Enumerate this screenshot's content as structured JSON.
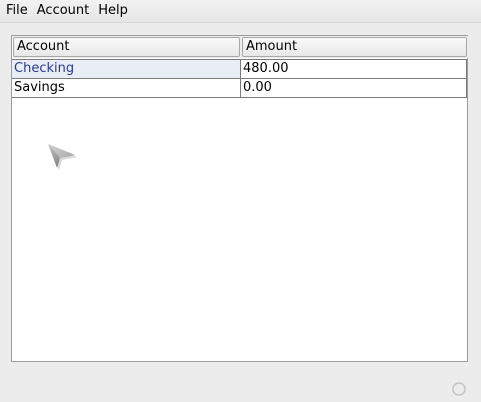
{
  "menubar": {
    "items": [
      {
        "label": "File"
      },
      {
        "label": "Account"
      },
      {
        "label": "Help"
      }
    ]
  },
  "table": {
    "columns": [
      "Account",
      "Amount"
    ],
    "rows": [
      {
        "account": "Checking",
        "amount": "480.00",
        "selected": true
      },
      {
        "account": "Savings",
        "amount": "0.00",
        "selected": false
      }
    ]
  },
  "icons": {
    "cursor": "mouse-pointer-icon",
    "status": "busy-indicator-icon"
  }
}
